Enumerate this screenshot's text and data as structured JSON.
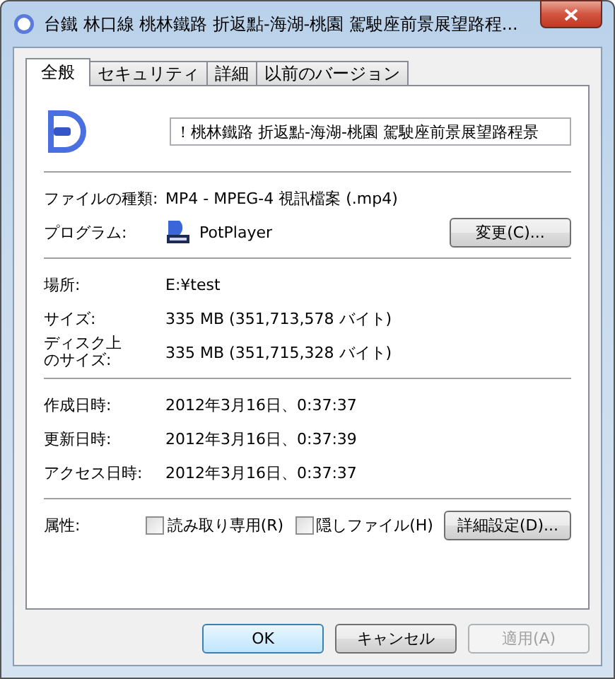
{
  "window": {
    "title": "台鐵 林口線 桃林鐵路 折返點-海湖-桃園 駕駛座前景展望路程..."
  },
  "tabs": [
    {
      "label": "全般",
      "selected": true
    },
    {
      "label": "セキュリティ",
      "selected": false
    },
    {
      "label": "詳細",
      "selected": false
    },
    {
      "label": "以前のバージョン",
      "selected": false
    }
  ],
  "file_name": {
    "value": "！桃林鐵路 折返點-海湖-桃園 駕駛座前景展望路程景"
  },
  "groups": [
    [
      {
        "label": "ファイルの種類:",
        "value": "MP4 - MPEG-4 視訊檔案 (.mp4)"
      },
      {
        "label": "プログラム:",
        "value": "PotPlayer",
        "kind": "program",
        "button": "変更(C)..."
      }
    ],
    [
      {
        "label": "場所:",
        "value": "E:¥test"
      },
      {
        "label": "サイズ:",
        "value": "335 MB (351,713,578 バイト)"
      },
      {
        "label_lines": [
          "ディスク上",
          "のサイズ:"
        ],
        "value": "335 MB (351,715,328 バイト)"
      }
    ],
    [
      {
        "label": "作成日時:",
        "value": "2012年3月16日、0:37:37"
      },
      {
        "label": "更新日時:",
        "value": "2012年3月16日、0:37:39"
      },
      {
        "label": "アクセス日時:",
        "value": "2012年3月16日、0:37:37"
      }
    ]
  ],
  "attributes": {
    "label": "属性:",
    "checkboxes": [
      {
        "label": "読み取り専用(R)",
        "checked": false
      },
      {
        "label": "隠しファイル(H)",
        "checked": false
      }
    ],
    "button": "詳細設定(D)..."
  },
  "buttons": [
    {
      "label": "OK",
      "default": true,
      "disabled": false
    },
    {
      "label": "キャンセル",
      "default": false,
      "disabled": false
    },
    {
      "label": "適用(A)",
      "default": false,
      "disabled": true
    }
  ]
}
